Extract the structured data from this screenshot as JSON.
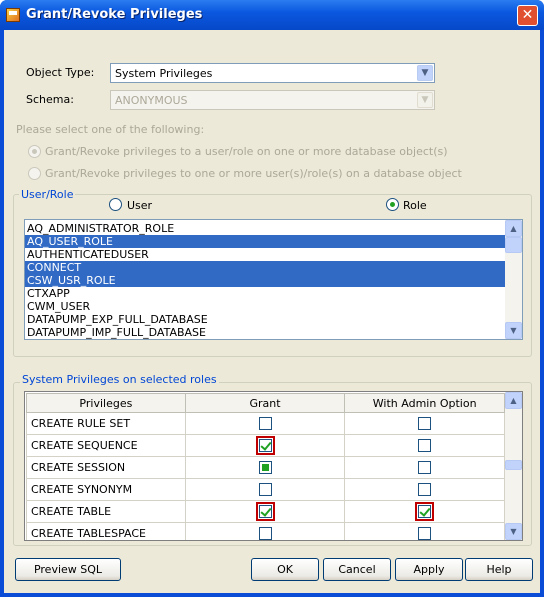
{
  "window": {
    "title": "Grant/Revoke Privileges"
  },
  "form": {
    "object_type_label": "Object Type:",
    "object_type_value": "System Privileges",
    "schema_label": "Schema:",
    "schema_value": "ANONYMOUS",
    "prompt": "Please select one of the following:",
    "option1": "Grant/Revoke privileges to a user/role on one or more database object(s)",
    "option2": "Grant/Revoke privileges to one or more user(s)/role(s) on a database object"
  },
  "user_role": {
    "group_title": "User/Role",
    "radio_user": "User",
    "radio_role": "Role",
    "selected_radio": "Role",
    "items": [
      {
        "label": "AQ_ADMINISTRATOR_ROLE",
        "selected": false
      },
      {
        "label": "AQ_USER_ROLE",
        "selected": true
      },
      {
        "label": "AUTHENTICATEDUSER",
        "selected": false
      },
      {
        "label": "CONNECT",
        "selected": true
      },
      {
        "label": "CSW_USR_ROLE",
        "selected": true
      },
      {
        "label": "CTXAPP",
        "selected": false
      },
      {
        "label": "CWM_USER",
        "selected": false
      },
      {
        "label": "DATAPUMP_EXP_FULL_DATABASE",
        "selected": false
      },
      {
        "label": "DATAPUMP_IMP_FULL_DATABASE",
        "selected": false
      }
    ]
  },
  "privileges": {
    "group_title": "System Privileges on selected roles",
    "headers": [
      "Privileges",
      "Grant",
      "With Admin Option"
    ],
    "rows": [
      {
        "name": "CREATE RULE SET",
        "grant": "off",
        "admin": "off",
        "grant_hl": false,
        "admin_hl": false
      },
      {
        "name": "CREATE SEQUENCE",
        "grant": "on",
        "admin": "off",
        "grant_hl": true,
        "admin_hl": false
      },
      {
        "name": "CREATE SESSION",
        "grant": "partial",
        "admin": "off",
        "grant_hl": false,
        "admin_hl": false
      },
      {
        "name": "CREATE SYNONYM",
        "grant": "off",
        "admin": "off",
        "grant_hl": false,
        "admin_hl": false
      },
      {
        "name": "CREATE TABLE",
        "grant": "on",
        "admin": "on",
        "grant_hl": true,
        "admin_hl": true
      },
      {
        "name": "CREATE TABLESPACE",
        "grant": "off",
        "admin": "off",
        "grant_hl": false,
        "admin_hl": false
      }
    ]
  },
  "buttons": {
    "preview_sql": "Preview SQL",
    "ok": "OK",
    "cancel": "Cancel",
    "apply": "Apply",
    "help": "Help"
  }
}
